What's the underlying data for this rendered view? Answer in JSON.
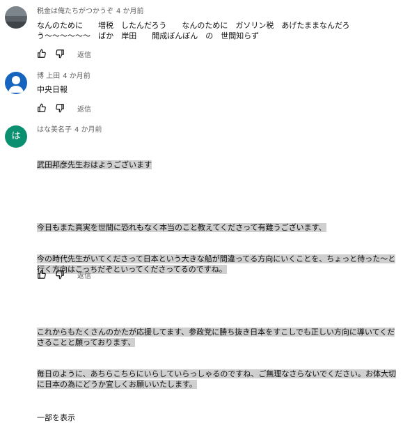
{
  "comments": [
    {
      "author": "税金は俺たちがつかうぞ",
      "time": "4 か月前",
      "text": "なんのために　　増税　したんだろう　　なんのために　ガソリン税　あげたままなんだろう〜〜〜〜〜〜　ばか　岸田　　開成ぼんぼん　の　世間知らず",
      "reply_label": "返信"
    },
    {
      "author": "博 上田",
      "time": "4 か月前",
      "text": "中央日報",
      "reply_label": "返信"
    },
    {
      "author": "はな美名子",
      "time": "4 か月前",
      "avatar_letter": "は",
      "paragraphs": [
        "武田邦彦先生おはようございます",
        "",
        "今日もまた真実を世間に恐れもなく本当のこと教えてくださって有難うございます、",
        "今の時代先生がいてくださって日本という大きな船が間違ってる方向にいくことを、ちょっと待った〜と行く方向はこっちだぞといってくださってるのですね。",
        "",
        "これからもたくさんのかたが応援してます、参政党に勝ち抜き日本をすこしでも正しい方向に導いてくださることと願っております、",
        "毎日のように、あちらこちらにいらしていらっしゃるのですね、ご無理なさらないでください。お体大切に日本の為にどうか宜しくお願いいたします。"
      ],
      "more_label": "一部を表示",
      "reply_label": "返信"
    }
  ],
  "colors": {
    "avatar3_bg": "#0b8f71",
    "highlight": "#cfcfcf",
    "meta_text": "#606060"
  },
  "icons": {
    "like": "thumbs-up-icon",
    "dislike": "thumbs-down-icon"
  }
}
